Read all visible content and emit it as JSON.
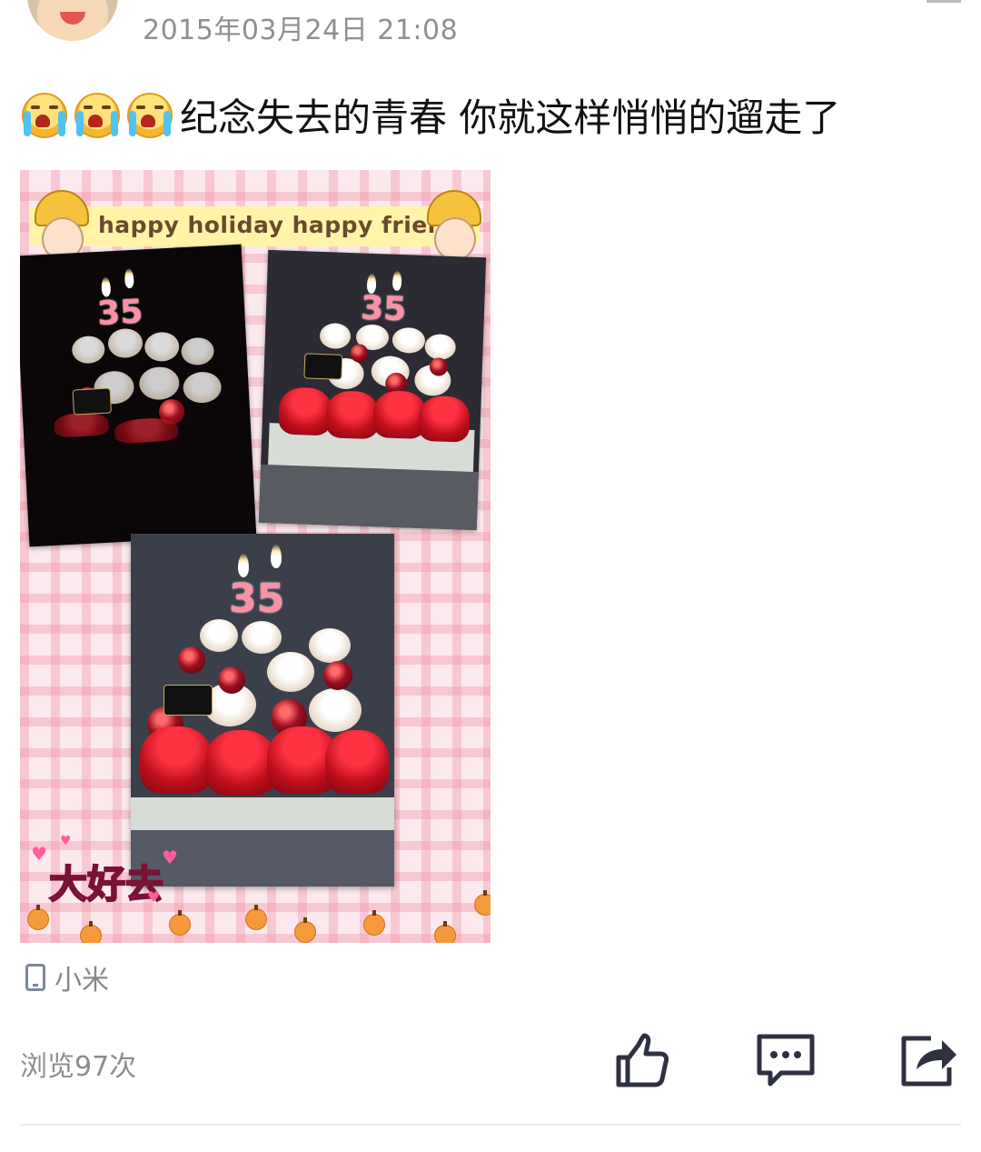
{
  "post": {
    "timestamp": "2015年03月24日 21:08",
    "emojis": [
      "crying-emoji",
      "crying-emoji",
      "crying-emoji"
    ],
    "text": "纪念失去的青春  你就这样悄悄的遛走了"
  },
  "photo": {
    "banner_text": "happy holiday happy friends",
    "candle_number": "35",
    "sticker_text": "大好去"
  },
  "meta": {
    "device_label": "小米",
    "views_label": "浏览97次"
  },
  "actions": {
    "like_icon": "thumbs-up-icon",
    "comment_icon": "comment-icon",
    "share_icon": "share-icon"
  }
}
